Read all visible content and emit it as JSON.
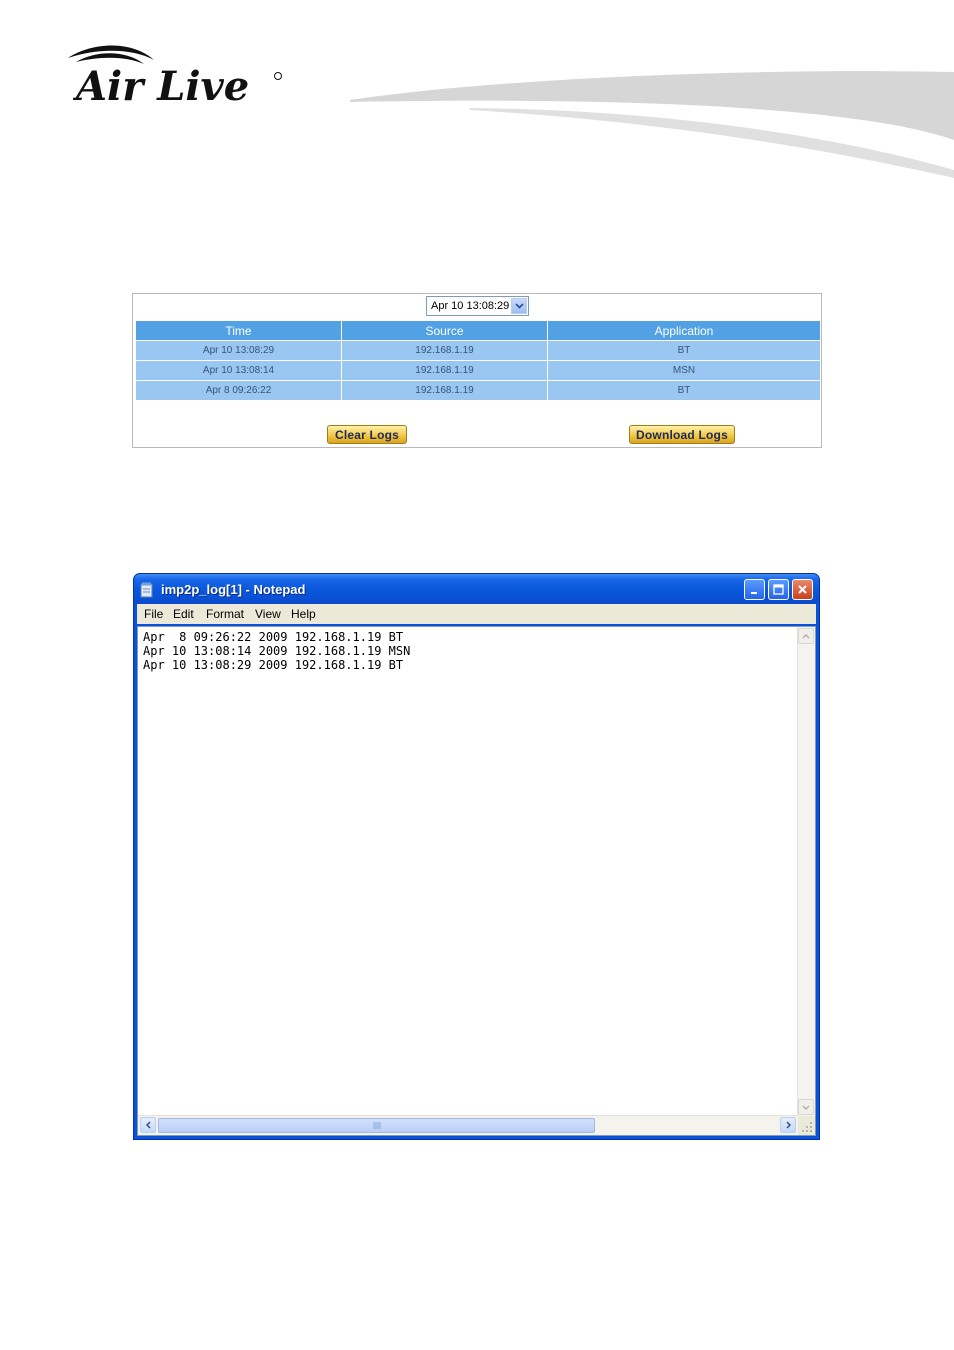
{
  "brand": {
    "name": "Air Live"
  },
  "log_panel": {
    "time_select": {
      "selected": "Apr 10 13:08:29"
    },
    "columns": [
      "Time",
      "Source",
      "Application"
    ],
    "rows": [
      [
        "Apr 10 13:08:29",
        "192.168.1.19",
        "BT"
      ],
      [
        "Apr 10 13:08:14",
        "192.168.1.19",
        "MSN"
      ],
      [
        "Apr 8 09:26:22",
        "192.168.1.19",
        "BT"
      ]
    ],
    "clear_button": "Clear Logs",
    "download_button": "Download Logs"
  },
  "notepad": {
    "title": "imp2p_log[1] - Notepad",
    "menu": [
      "File",
      "Edit",
      "Format",
      "View",
      "Help"
    ],
    "lines": [
      "Apr  8 09:26:22 2009 192.168.1.19 BT",
      "Apr 10 13:08:14 2009 192.168.1.19 MSN",
      "Apr 10 13:08:29 2009 192.168.1.19 BT"
    ]
  }
}
